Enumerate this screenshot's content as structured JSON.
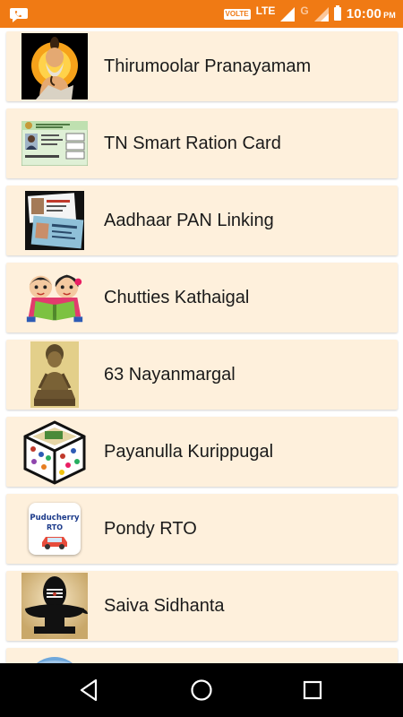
{
  "status_bar": {
    "volte": "VOLTE",
    "network_1": "LTE",
    "network_2": "G",
    "time": "10:00",
    "ampm": "PM"
  },
  "list": {
    "items": [
      {
        "label": "Thirumoolar Pranayamam",
        "icon": "sage-meditating-icon"
      },
      {
        "label": "TN Smart Ration Card",
        "icon": "ration-card-icon"
      },
      {
        "label": "Aadhaar PAN Linking",
        "icon": "aadhaar-pan-cards-icon"
      },
      {
        "label": "Chutties Kathaigal",
        "icon": "kids-reading-book-icon"
      },
      {
        "label": "63 Nayanmargal",
        "icon": "saint-statue-icon"
      },
      {
        "label": "Payanulla Kurippugal",
        "icon": "tips-cube-icon"
      },
      {
        "label": "Pondy RTO",
        "icon": "puducherry-rto-car-icon",
        "icon_text_1": "Puducherry",
        "icon_text_2": "RTO"
      },
      {
        "label": "Saiva Sidhanta",
        "icon": "shiva-lingam-icon"
      }
    ]
  },
  "nav_bar": {
    "back": "back-icon",
    "home": "home-icon",
    "recents": "recents-icon"
  },
  "colors": {
    "status_bar": "#f07a14",
    "card_background": "#fef0dc",
    "nav_bar": "#000000"
  }
}
